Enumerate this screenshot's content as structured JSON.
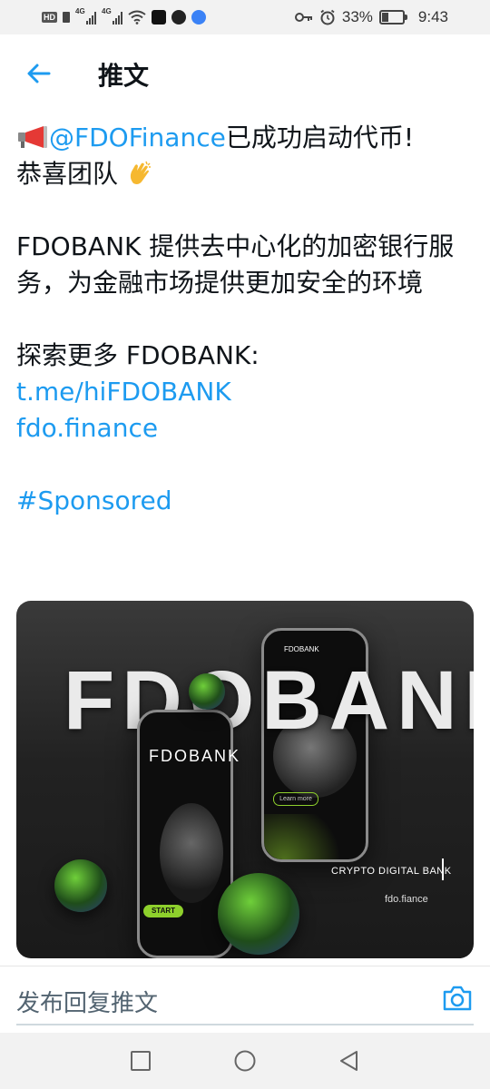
{
  "status_bar": {
    "hd": "HD",
    "net1": "4G",
    "net2": "4G",
    "battery_percent": "33%",
    "time": "9:43"
  },
  "header": {
    "title": "推文"
  },
  "tweet": {
    "mention": "@FDOFinance",
    "line1_rest": "已成功启动代币!",
    "line2": "恭喜团队",
    "para2": "FDOBANK 提供去中心化的加密银行服务，为金融市场提供更加安全的环境",
    "explore": "探索更多 FDOBANK:",
    "link1": "t.me/hiFDOBANK",
    "link2": "fdo.finance",
    "hashtag": "#Sponsored"
  },
  "media": {
    "headline": "FDOBANK",
    "front_phone_brand": "FDOBANK",
    "back_phone_brand": "FDOBANK",
    "start_label": "START",
    "learn_label": "Learn more",
    "tagline": "CRYPTO DIGITAL BANK",
    "url": "fdo.fiance"
  },
  "reply": {
    "placeholder": "发布回复推文"
  },
  "colors": {
    "link": "#1d9bf0",
    "text": "#0f1419",
    "accent_green": "#8ed02c"
  }
}
